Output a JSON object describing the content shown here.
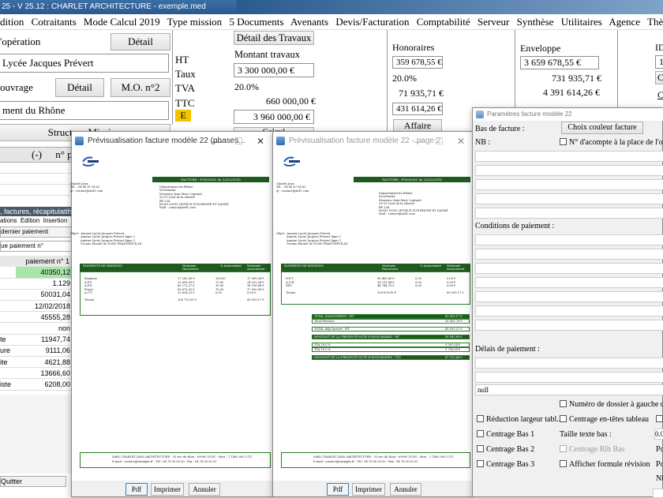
{
  "app": {
    "title": "25 - V 25.12 : CHARLET ARCHITECTURE - exemple.med"
  },
  "menu": [
    "dition",
    "Cotraitants",
    "Mode Calcul 2019",
    "Type mission",
    "5 Documents",
    "Avenants",
    "Devis/Facturation",
    "Comptabilité",
    "Serveur",
    "Synthèse",
    "Utilitaires",
    "Agence",
    "Thème",
    "?"
  ],
  "left": {
    "operation_label": "'opération",
    "detail_button": "Détail",
    "operation_value": "Lycée Jacques Prévert",
    "ouvrage_label": "ouvrage",
    "detail2_button": "Détail",
    "mo_button": "M.O. n°2",
    "maitre_value": "ment du Rhône",
    "structure_button": "Structure Mission",
    "header_minus": "(-)",
    "header_np": "n° p"
  },
  "mid": {
    "detail_travaux_button": "Détail des Travaux",
    "montant_label": "Montant travaux",
    "ht_label": "HT",
    "taux_label": "Taux",
    "tva_label": "TVA",
    "ttc_label": "TTC",
    "e_label": "E",
    "ht_value": "3 300 000,00 €",
    "taux_value": "20.0%",
    "tva_value": "660 000,00 €",
    "ttc_value": "3 960 000,00 €",
    "calc_button": "Calcul"
  },
  "honoraires": {
    "title": "Honoraires",
    "ht": "359 678,55 €",
    "taux": "20.0%",
    "tva": "71 935,71 €",
    "ttc": "431 614,26 €",
    "affaire_button": "Affaire"
  },
  "enveloppe": {
    "title": "Enveloppe",
    "ht": "3 659 678,55 €",
    "tva": "731 935,71 €",
    "ttc": "4 391 614,26 €"
  },
  "id_col": {
    "title": "ID",
    "v1": "1",
    "v2": "C",
    "v3": "C"
  },
  "sub": {
    "bar_label": ", factures, récapitulatifs",
    "menu_items": [
      "ations",
      "Edition",
      "Insertion"
    ],
    "btn1": "dernier paiement",
    "select1": "ue paiement n°",
    "col_header": "paiement n° 1",
    "rows": [
      {
        "label": "",
        "value": "40350,12"
      },
      {
        "label": "",
        "value": "1.129"
      },
      {
        "label": "",
        "value": "50031,04"
      },
      {
        "label": "",
        "value": "12/02/2018"
      },
      {
        "label": "",
        "value": "45555,28"
      },
      {
        "label": "",
        "value": "non"
      },
      {
        "label": "te",
        "value": "11947,74"
      },
      {
        "label": "ure",
        "value": "9111,06"
      },
      {
        "label": "ite",
        "value": "4621,88"
      },
      {
        "label": "",
        "value": "13666,60"
      },
      {
        "label": "iste",
        "value": "6208,00"
      }
    ],
    "quit_button": "Quitter"
  },
  "preview1": {
    "title": "Prévisualisation facture modèle 22 (phases...",
    "facture_header": "FACTURE : F0002001 du 22/02/2018",
    "client_lines": [
      "Charlet Jean",
      "Tél. : 04 88 67 98 82",
      "@ : contact@xrd1.com"
    ],
    "dest_lines": [
      "Département du Rhône",
      "Secrétariat",
      "Monsieur Jean-Marc Legrand",
      "29-31 Cour de la Liberté",
      "BP 234",
      "69003 LYON LEVIEUX SUR RHONE ET SAONE",
      "Mail : contact@xrd1.com"
    ],
    "objet_lines": [
      "Objet : Annexe Lycée Jacques Prévert",
      "Annexe Lycée Jacques Prévert ligne 2",
      "Annexe Lycée Jacques Prévert ligne 3",
      "Yvonne Ennuie de 10000 FRANCHEVILLE"
    ],
    "table_headers": [
      "ELEMENTS DE MISSIONS",
      "Montants Honoraires",
      "% Avancement",
      "Montants Avancement"
    ],
    "rows": [
      [
        "Esquisse",
        "17 289,36 €",
        "100,00",
        "17 289,36 €"
      ],
      [
        "A.P.S.",
        "32 698,99 €",
        "75,00",
        "24 523,54 €"
      ],
      [
        "A.P.D.",
        "60 172,37 €",
        "30,00",
        "18 136,48 €"
      ],
      [
        "Projet",
        "69 670,00 €",
        "15,00",
        "17 000,96 €"
      ],
      [
        "A.C.T.",
        "23 624,23 €",
        "0,00",
        "0,00 €"
      ]
    ],
    "totals": [
      "Totaux",
      "204 792,95 €",
      "",
      "89 059,17 €"
    ],
    "footer1": "SARL CHARLET JEAN ARCHITECTURE - 35 rue du Haut - 69000 LYON - Siret : 1 1400 000 1111",
    "footer2": "E-mail : contact@exemple.fr - Tél : 04 78 00 00 00 - Fax : 04 78 00 00 01",
    "buttons": [
      "Pdf",
      "Imprimer",
      "Annuler"
    ]
  },
  "preview2": {
    "title": "Prévisualisation facture modèle 22 - page 2",
    "facture_header": "FACTURE : F0002001 du 22/02/2018",
    "client_lines": [
      "Charlet Jean",
      "Tél. : 04 88 67 98 82",
      "@ : contact@xrd1.com"
    ],
    "dest_lines": [
      "Département du Rhône",
      "Secrétariat",
      "Monsieur Jean-Marc Legrand",
      "29-31 Cour de la Liberté",
      "BP 234",
      "69003 LYON LEVIEUX SUR RHONE ET SAONE",
      "Mail : contact@xrd1.com"
    ],
    "objet_lines": [
      "Objet : Annexe Lycée Jacques Prévert",
      "Annexe Lycée Jacques Prévert ligne 2",
      "Annexe Lycée Jacques Prévert ligne 3",
      "Yvonne Ennuie de 10000 FRANCHEVILLE"
    ],
    "table_headers": [
      "ELEMENTS DE MISSIONS",
      "Montants Honoraires",
      "% Avancement",
      "Montants Avancement"
    ],
    "rows": [
      [
        "D.E.T.",
        "89 460,49 €",
        "0,00",
        "0,00 €"
      ],
      [
        "A.O.R.",
        "26 131,44 €",
        "0,00",
        "0,00 €"
      ],
      [
        "OPC",
        "44 744,70 €",
        "0,00",
        "0,00 €"
      ]
    ],
    "totals": [
      "Totaux",
      "359 678,55 €",
      "",
      "89 059,17 €"
    ],
    "summary": [
      [
        "TOTAL AVANCEMENT - HT",
        "89 059,17 €"
      ],
      [
        "Total Révision",
        "16 581,79 €"
      ],
      [
        "TOTAL déjà facturé - HT",
        "49 553,27 €"
      ],
      [
        "MONTANT DE LA PRESENTE NOTE D'HONORAIRES - HT",
        "56 085,69 €"
      ],
      [
        "TVA 20.0 %",
        "5 567,04 €"
      ],
      [
        "TVA 10.0 %",
        "1 750,95 €"
      ],
      [
        "MONTANT DE LA PRESENTE NOTE D'HONORAIRES - TTC",
        "67 313,68 €"
      ]
    ],
    "footer1": "SARL CHARLET JEAN ARCHITECTURE - 35 rue du Haut - 69000 LYON - Siret : 1 1400 000 1111",
    "footer2": "E-mail : contact@exemple.fr - Tél : 04 78 00 00 00 - Fax : 04 78 00 00 01",
    "buttons": [
      "Pdf",
      "Imprimer",
      "Annuler"
    ]
  },
  "params": {
    "title": "Paramètres facture modèle 22",
    "bas_label": "Bas de facture :",
    "color_button": "Choix couleur facture",
    "nb_label": "NB :",
    "acompte_label": "N° d'acompte à la place de l'objet",
    "conditions_label": "Conditions de paiement :",
    "delais_label": "Délais de paiement :",
    "null_value": "null",
    "dossier_label": "Numéro de dossier à gauche du n",
    "reduction_label": "Réduction largeur tabl...",
    "centrage_entetes_label": "Centrage en-têtes tableau",
    "centrage_bas1_label": "Centrage Bas 1",
    "taille_label": "Taille texte bas :",
    "taille_value": "0.0",
    "centrage_bas2_label": "Centrage Bas 2",
    "centrage_rib_label": "Centrage Rib Bas",
    "pos1": "Pos",
    "centrage_bas3_label": "Centrage Bas 3",
    "formule_label": "Afficher formule révision",
    "pos2": "Pos",
    "nb2": "Nb"
  }
}
